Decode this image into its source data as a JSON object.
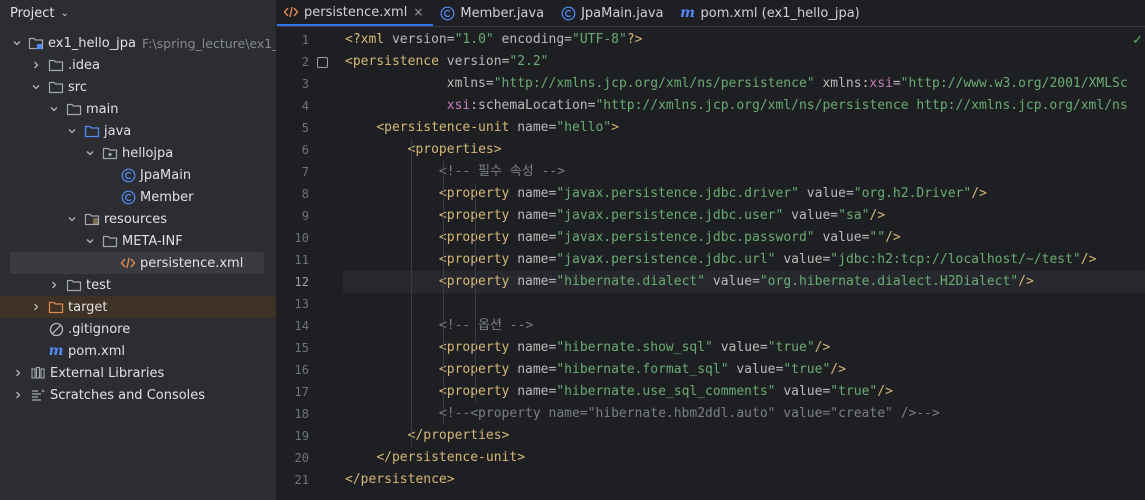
{
  "sidebar": {
    "title": "Project",
    "tree": [
      {
        "label": "ex1_hello_jpa",
        "hint": "F:\\spring_lecture\\ex1_",
        "depth": 0,
        "arrow": "down",
        "icon": "module-folder-icon"
      },
      {
        "label": ".idea",
        "depth": 1,
        "arrow": "right",
        "icon": "folder-icon"
      },
      {
        "label": "src",
        "depth": 1,
        "arrow": "down",
        "icon": "folder-icon"
      },
      {
        "label": "main",
        "depth": 2,
        "arrow": "down",
        "icon": "folder-icon"
      },
      {
        "label": "java",
        "depth": 3,
        "arrow": "down",
        "icon": "source-folder-icon"
      },
      {
        "label": "hellojpa",
        "depth": 4,
        "arrow": "down",
        "icon": "package-icon"
      },
      {
        "label": "JpaMain",
        "depth": 5,
        "arrow": "none",
        "icon": "class-icon"
      },
      {
        "label": "Member",
        "depth": 5,
        "arrow": "none",
        "icon": "class-icon"
      },
      {
        "label": "resources",
        "depth": 3,
        "arrow": "down",
        "icon": "resources-folder-icon"
      },
      {
        "label": "META-INF",
        "depth": 4,
        "arrow": "down",
        "icon": "folder-icon"
      },
      {
        "label": "persistence.xml",
        "depth": 5,
        "arrow": "none",
        "icon": "xml-file-icon",
        "selected": true
      },
      {
        "label": "test",
        "depth": 2,
        "arrow": "right",
        "icon": "folder-icon"
      },
      {
        "label": "target",
        "depth": 1,
        "arrow": "right",
        "icon": "excluded-folder-icon",
        "excluded": true
      },
      {
        "label": ".gitignore",
        "depth": 1,
        "arrow": "none",
        "icon": "gitignore-icon"
      },
      {
        "label": "pom.xml",
        "depth": 1,
        "arrow": "none",
        "icon": "maven-icon"
      },
      {
        "label": "External Libraries",
        "depth": 0,
        "arrow": "right",
        "icon": "library-icon"
      },
      {
        "label": "Scratches and Consoles",
        "depth": 0,
        "arrow": "right",
        "icon": "scratches-icon"
      }
    ]
  },
  "tabs": [
    {
      "label": "persistence.xml",
      "icon": "xml-file-icon",
      "active": true,
      "close": "×"
    },
    {
      "label": "Member.java",
      "icon": "class-icon"
    },
    {
      "label": "JpaMain.java",
      "icon": "class-icon"
    },
    {
      "label": "pom.xml (ex1_hello_jpa)",
      "icon": "maven-icon"
    }
  ],
  "editor": {
    "current_line": 12,
    "status_mark": "✓",
    "lines": [
      [
        [
          "pi",
          "<?xml "
        ],
        [
          "attr",
          "version="
        ],
        [
          "val",
          "\"1.0\""
        ],
        [
          "attr",
          " encoding="
        ],
        [
          "val",
          "\"UTF-8\""
        ],
        [
          "pi",
          "?>"
        ]
      ],
      [
        [
          "tag",
          "<persistence "
        ],
        [
          "attr",
          "version="
        ],
        [
          "val",
          "\"2.2\""
        ]
      ],
      [
        [
          "plain",
          "             "
        ],
        [
          "attr",
          "xmlns="
        ],
        [
          "val",
          "\"http://xmlns.jcp.org/xml/ns/persistence\""
        ],
        [
          "attr",
          " xmlns:"
        ],
        [
          "ns",
          "xsi"
        ],
        [
          "attr",
          "="
        ],
        [
          "val",
          "\"http://www.w3.org/2001/XMLSc"
        ]
      ],
      [
        [
          "plain",
          "             "
        ],
        [
          "ns",
          "xsi"
        ],
        [
          "attr",
          ":schemaLocation="
        ],
        [
          "val",
          "\"http://xmlns.jcp.org/xml/ns/persistence http://xmlns.jcp.org/xml/ns"
        ]
      ],
      [
        [
          "plain",
          "    "
        ],
        [
          "tag",
          "<persistence-unit "
        ],
        [
          "attr",
          "name="
        ],
        [
          "val",
          "\"hello\""
        ],
        [
          "tag",
          ">"
        ]
      ],
      [
        [
          "plain",
          "        "
        ],
        [
          "tag",
          "<properties>"
        ]
      ],
      [
        [
          "plain",
          "            "
        ],
        [
          "com",
          "<!-- 필수 속성 -->"
        ]
      ],
      [
        [
          "plain",
          "            "
        ],
        [
          "tag",
          "<property "
        ],
        [
          "attr",
          "name="
        ],
        [
          "val",
          "\"javax.persistence.jdbc.driver\""
        ],
        [
          "attr",
          " value="
        ],
        [
          "val",
          "\"org.h2.Driver\""
        ],
        [
          "tag",
          "/>"
        ]
      ],
      [
        [
          "plain",
          "            "
        ],
        [
          "tag",
          "<property "
        ],
        [
          "attr",
          "name="
        ],
        [
          "val",
          "\"javax.persistence.jdbc.user\""
        ],
        [
          "attr",
          " value="
        ],
        [
          "val",
          "\"sa\""
        ],
        [
          "tag",
          "/>"
        ]
      ],
      [
        [
          "plain",
          "            "
        ],
        [
          "tag",
          "<property "
        ],
        [
          "attr",
          "name="
        ],
        [
          "val",
          "\"javax.persistence.jdbc.password\""
        ],
        [
          "attr",
          " value="
        ],
        [
          "val",
          "\"\""
        ],
        [
          "tag",
          "/>"
        ]
      ],
      [
        [
          "plain",
          "            "
        ],
        [
          "tag",
          "<property "
        ],
        [
          "attr",
          "name="
        ],
        [
          "val",
          "\"javax.persistence.jdbc.url\""
        ],
        [
          "attr",
          " value="
        ],
        [
          "val",
          "\"jdbc:h2:tcp://localhost/~/test\""
        ],
        [
          "tag",
          "/>"
        ]
      ],
      [
        [
          "plain",
          "            "
        ],
        [
          "tag",
          "<property "
        ],
        [
          "attr",
          "name="
        ],
        [
          "val",
          "\"hibernate.dialect\""
        ],
        [
          "attr",
          " value="
        ],
        [
          "val",
          "\"org.hibernate.dialect.H2Dialect\""
        ],
        [
          "tag",
          "/>"
        ]
      ],
      [],
      [
        [
          "plain",
          "            "
        ],
        [
          "com",
          "<!-- 옵션 -->"
        ]
      ],
      [
        [
          "plain",
          "            "
        ],
        [
          "tag",
          "<property "
        ],
        [
          "attr",
          "name="
        ],
        [
          "val",
          "\"hibernate.show_sql\""
        ],
        [
          "attr",
          " value="
        ],
        [
          "val",
          "\"true\""
        ],
        [
          "tag",
          "/>"
        ]
      ],
      [
        [
          "plain",
          "            "
        ],
        [
          "tag",
          "<property "
        ],
        [
          "attr",
          "name="
        ],
        [
          "val",
          "\"hibernate.format_sql\""
        ],
        [
          "attr",
          " value="
        ],
        [
          "val",
          "\"true\""
        ],
        [
          "tag",
          "/>"
        ]
      ],
      [
        [
          "plain",
          "            "
        ],
        [
          "tag",
          "<property "
        ],
        [
          "attr",
          "name="
        ],
        [
          "val",
          "\"hibernate.use_sql_comments\""
        ],
        [
          "attr",
          " value="
        ],
        [
          "val",
          "\"true\""
        ],
        [
          "tag",
          "/>"
        ]
      ],
      [
        [
          "plain",
          "            "
        ],
        [
          "com",
          "<!--<property name=\"hibernate.hbm2ddl.auto\" value=\"create\" />-->"
        ]
      ],
      [
        [
          "plain",
          "        "
        ],
        [
          "tag",
          "</properties>"
        ]
      ],
      [
        [
          "plain",
          "    "
        ],
        [
          "tag",
          "</persistence-unit>"
        ]
      ],
      [
        [
          "tag",
          "</persistence>"
        ]
      ]
    ]
  },
  "colors": {
    "accent": "#3574f0",
    "folder": "#a3a7b0",
    "source_folder": "#548af7",
    "excluded_folder": "#e08855",
    "class_icon": "#548af7",
    "xml_icon": "#e08855"
  }
}
